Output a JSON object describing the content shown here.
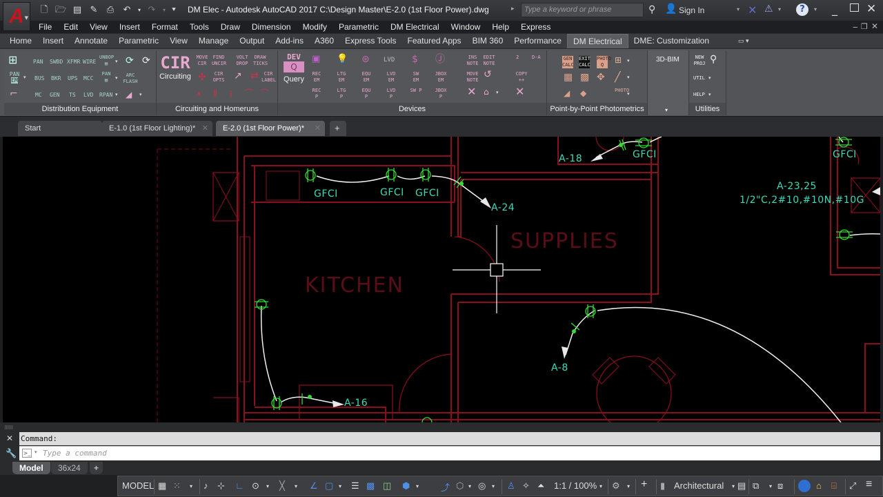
{
  "titlebar": {
    "app_icon": "autocad-logo",
    "quick_access": [
      "new-icon",
      "open-icon",
      "save-icon",
      "save-as-icon",
      "plot-icon",
      "undo-icon",
      "redo-icon",
      "customize-qat-icon"
    ],
    "title": "DM Elec - Autodesk AutoCAD 2017    C:\\Design Master\\E-2.0 (1st Floor Power).dwg",
    "search_placeholder": "Type a keyword or phrase",
    "sign_in": "Sign In"
  },
  "menubar": [
    "File",
    "Edit",
    "View",
    "Insert",
    "Format",
    "Tools",
    "Draw",
    "Dimension",
    "Modify",
    "Parametric",
    "DM Electrical",
    "Window",
    "Help",
    "Express"
  ],
  "ribbon_tabs": [
    "Home",
    "Insert",
    "Annotate",
    "Parametric",
    "View",
    "Manage",
    "Output",
    "Add-ins",
    "A360",
    "Express Tools",
    "Featured Apps",
    "BIM 360",
    "Performance",
    "DM Electrical",
    "DME: Customization"
  ],
  "active_ribbon_tab": "DM Electrical",
  "ribbon": {
    "distribution": {
      "title": "Distribution Equipment",
      "buttons": [
        "PAN",
        "SWBD",
        "XFMR",
        "WIRE",
        "BUS",
        "BKR",
        "UPS",
        "MCC",
        "MC",
        "GEN",
        "TS",
        "LVD",
        "RPAN",
        "ARC FLASH",
        "UNBOP",
        "PAN EM"
      ]
    },
    "circuiting": {
      "title": "Circuiting and Homeruns",
      "big_label": "CIR",
      "big_caption": "Circuiting",
      "buttons": [
        "MOVE CIR",
        "FIND UNCIR",
        "VOLT DROP",
        "DRAW TICKS",
        "CIR OPTS",
        "CIR LABEL"
      ]
    },
    "devices": {
      "title": "Devices",
      "big_label": "DEV",
      "big_caption": "Query",
      "buttons": [
        "LVD",
        "REC EM",
        "LTG EM",
        "EQU EM",
        "LVD EM",
        "SW EM",
        "JBOX EM",
        "REC P",
        "LTG P",
        "EQU P",
        "LVD P",
        "SW P",
        "JBOX P",
        "INS NOTE",
        "EDIT NOTE",
        "MOVE NOTE",
        "COPY ++",
        "2",
        "D-A"
      ]
    },
    "photometrics": {
      "title": "Point-by-Point Photometrics",
      "buttons": [
        "GEN CALC",
        "EXIT CALC",
        "PHOTO Q",
        "PHOTO"
      ]
    },
    "bim": {
      "label": "3D-BIM"
    },
    "utilities": {
      "title": "Utilities",
      "buttons": [
        "NEW PROJ",
        "UTIL",
        "HELP"
      ]
    }
  },
  "doc_tabs": [
    {
      "label": "Start",
      "active": false
    },
    {
      "label": "E-1.0 (1st Floor Lighting)*",
      "active": false
    },
    {
      "label": "E-2.0 (1st Floor Power)*",
      "active": true
    }
  ],
  "drawing": {
    "rooms": [
      "KITCHEN",
      "SUPPLIES"
    ],
    "labels": {
      "gfci": "GFCI",
      "a24": "A-24",
      "a18": "A-18",
      "a16": "A-16",
      "a8": "A-8",
      "a2325": "A-23,25",
      "conduit": "1/2\"C,2#10,#10N,#10G"
    },
    "colors": {
      "walls": "#8a0f1f",
      "devices": "#33dd33",
      "text": "#3fd9b8",
      "wires": "#f0f0f0"
    }
  },
  "command": {
    "history": "Command:",
    "placeholder": "Type a command"
  },
  "layout_tabs": [
    "Model",
    "36x24"
  ],
  "statusbar": {
    "space": "MODEL",
    "scale": "1:1 / 100%",
    "units": "Architectural"
  }
}
